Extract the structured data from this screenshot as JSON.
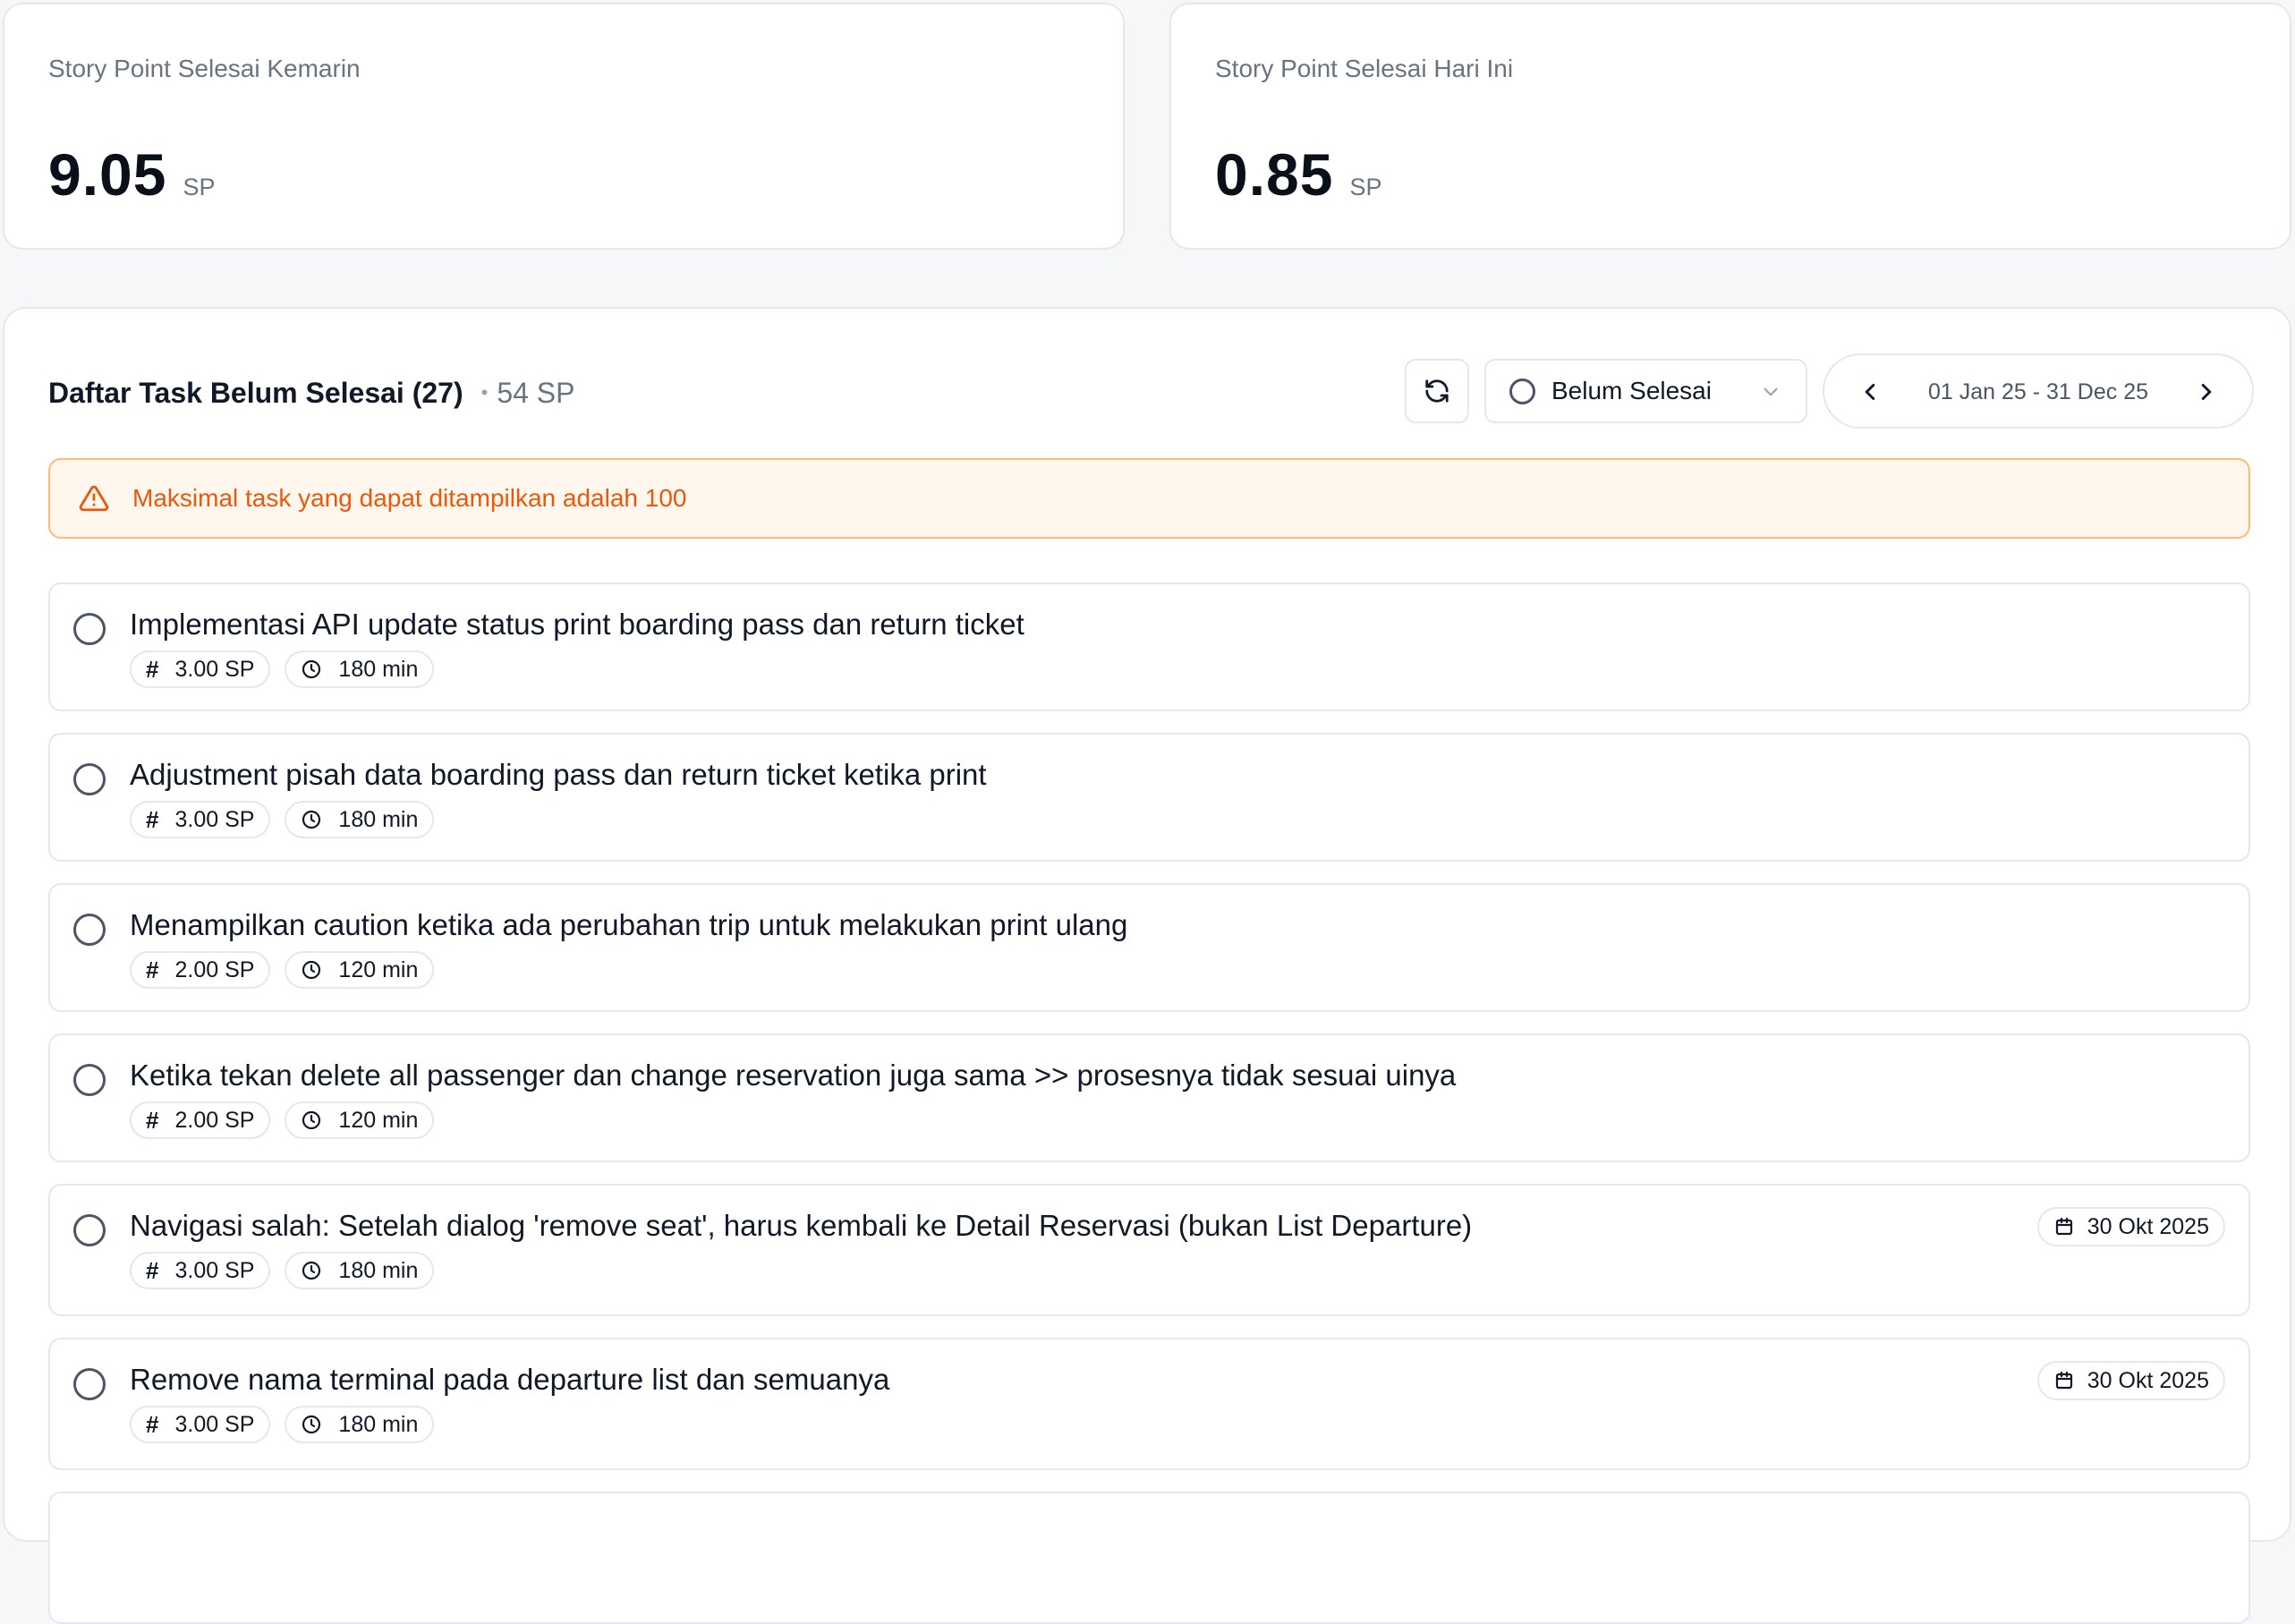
{
  "stats": {
    "yesterday": {
      "label": "Story Point Selesai Kemarin",
      "value": "9.05",
      "unit": "SP"
    },
    "today": {
      "label": "Story Point Selesai Hari Ini",
      "value": "0.85",
      "unit": "SP"
    }
  },
  "task_list": {
    "title": "Daftar Task Belum Selesai (27)",
    "separator": "•",
    "total_sp": "54 SP",
    "status_filter": {
      "selected": "Belum Selesai"
    },
    "date_range": "01 Jan 25 - 31 Dec 25",
    "warning": "Maksimal task yang dapat ditampilkan adalah 100",
    "tasks": [
      {
        "title": "Implementasi API update status print boarding pass dan return ticket",
        "sp": "3.00 SP",
        "duration": "180 min",
        "due": ""
      },
      {
        "title": "Adjustment pisah data boarding pass dan return ticket ketika print",
        "sp": "3.00 SP",
        "duration": "180 min",
        "due": ""
      },
      {
        "title": "Menampilkan caution ketika ada perubahan trip untuk melakukan print ulang",
        "sp": "2.00 SP",
        "duration": "120 min",
        "due": ""
      },
      {
        "title": "Ketika tekan delete all passenger dan change reservation juga sama >> prosesnya tidak sesuai uinya",
        "sp": "2.00 SP",
        "duration": "120 min",
        "due": ""
      },
      {
        "title": "Navigasi salah: Setelah dialog 'remove seat', harus kembali ke Detail Reservasi (bukan List Departure)",
        "sp": "3.00 SP",
        "duration": "180 min",
        "due": "30 Okt 2025"
      },
      {
        "title": "Remove nama terminal pada departure list dan semuanya",
        "sp": "3.00 SP",
        "duration": "180 min",
        "due": "30 Okt 2025"
      }
    ]
  },
  "colors": {
    "background": "#f6f7f9",
    "card": "#ffffff",
    "border": "#e5e7eb",
    "warning_bg": "#fff7ed",
    "warning_border": "#fdba74",
    "warning_text": "#ea580c"
  },
  "icons": {
    "refresh": "refresh-icon",
    "status": "circle-icon",
    "dropdown": "chevron-down-icon",
    "prev": "chevron-left-icon",
    "next": "chevron-right-icon",
    "warning": "warning-triangle-icon",
    "sp": "hash-icon",
    "duration": "clock-icon",
    "due": "calendar-icon"
  }
}
